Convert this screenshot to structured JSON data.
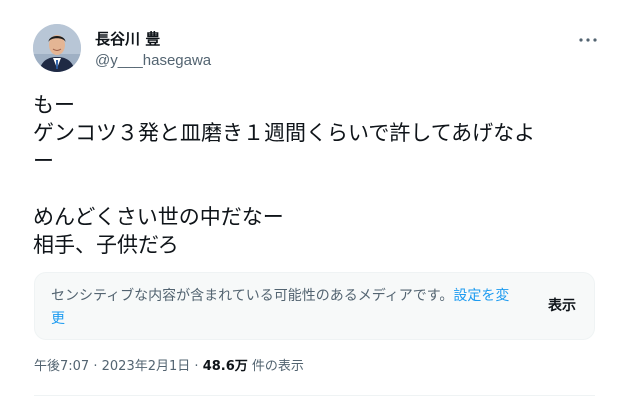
{
  "author": {
    "display_name": "長谷川 豊",
    "handle": "@y___hasegawa",
    "avatar_icon": "avatar-photo"
  },
  "header": {
    "more_icon": "more-horizontal-icon"
  },
  "tweet": {
    "lines": [
      "もー",
      "ゲンコツ３発と皿磨き１週間くらいで許してあげなよ",
      "ー",
      "",
      "めんどくさい世の中だなー",
      "相手、子供だろ"
    ]
  },
  "media_warning": {
    "text": "センシティブな内容が含まれている可能性のあるメディアです。",
    "settings_link": "設定を変更",
    "show_label": "表示"
  },
  "meta": {
    "time": "午後7:07",
    "separator": "·",
    "date": "2023年2月1日",
    "views_count": "48.6万",
    "views_label": "件の表示"
  },
  "colors": {
    "text_primary": "#0f1419",
    "text_secondary": "#536471",
    "link": "#1d9bf0",
    "warning_bg": "#f7f9f9"
  }
}
